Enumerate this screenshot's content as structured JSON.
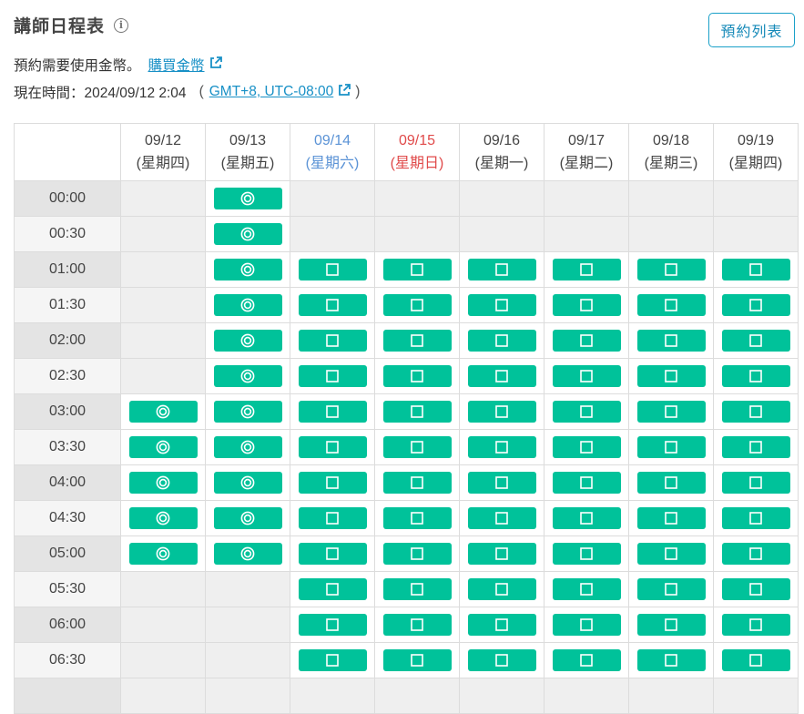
{
  "header": {
    "title": "講師日程表",
    "list_button": "預約列表"
  },
  "info": {
    "coins_text": "預約需要使用金幣。",
    "buy_link": "購買金幣",
    "time_label": "現在時間：2024/09/12 2:04",
    "paren_open": "(",
    "tz_link": "GMT+8, UTC-08:00",
    "paren_close": ")"
  },
  "schedule": {
    "days": [
      {
        "date": "09/12",
        "weekday": "(星期四)",
        "type": "weekday"
      },
      {
        "date": "09/13",
        "weekday": "(星期五)",
        "type": "weekday"
      },
      {
        "date": "09/14",
        "weekday": "(星期六)",
        "type": "saturday"
      },
      {
        "date": "09/15",
        "weekday": "(星期日)",
        "type": "sunday"
      },
      {
        "date": "09/16",
        "weekday": "(星期一)",
        "type": "weekday"
      },
      {
        "date": "09/17",
        "weekday": "(星期二)",
        "type": "weekday"
      },
      {
        "date": "09/18",
        "weekday": "(星期三)",
        "type": "weekday"
      },
      {
        "date": "09/19",
        "weekday": "(星期四)",
        "type": "weekday"
      }
    ],
    "legend": {
      "double_circle": "circle-slot-icon",
      "square": "square-slot-icon"
    },
    "rows": [
      {
        "time": "00:00",
        "slots": [
          "",
          "O",
          "",
          "",
          "",
          "",
          "",
          ""
        ]
      },
      {
        "time": "00:30",
        "slots": [
          "",
          "O",
          "",
          "",
          "",
          "",
          "",
          ""
        ]
      },
      {
        "time": "01:00",
        "slots": [
          "",
          "O",
          "S",
          "S",
          "S",
          "S",
          "S",
          "S"
        ]
      },
      {
        "time": "01:30",
        "slots": [
          "",
          "O",
          "S",
          "S",
          "S",
          "S",
          "S",
          "S"
        ]
      },
      {
        "time": "02:00",
        "slots": [
          "",
          "O",
          "S",
          "S",
          "S",
          "S",
          "S",
          "S"
        ]
      },
      {
        "time": "02:30",
        "slots": [
          "",
          "O",
          "S",
          "S",
          "S",
          "S",
          "S",
          "S"
        ]
      },
      {
        "time": "03:00",
        "slots": [
          "O",
          "O",
          "S",
          "S",
          "S",
          "S",
          "S",
          "S"
        ]
      },
      {
        "time": "03:30",
        "slots": [
          "O",
          "O",
          "S",
          "S",
          "S",
          "S",
          "S",
          "S"
        ]
      },
      {
        "time": "04:00",
        "slots": [
          "O",
          "O",
          "S",
          "S",
          "S",
          "S",
          "S",
          "S"
        ]
      },
      {
        "time": "04:30",
        "slots": [
          "O",
          "O",
          "S",
          "S",
          "S",
          "S",
          "S",
          "S"
        ]
      },
      {
        "time": "05:00",
        "slots": [
          "O",
          "O",
          "S",
          "S",
          "S",
          "S",
          "S",
          "S"
        ]
      },
      {
        "time": "05:30",
        "slots": [
          "",
          "",
          "S",
          "S",
          "S",
          "S",
          "S",
          "S"
        ]
      },
      {
        "time": "06:00",
        "slots": [
          "",
          "",
          "S",
          "S",
          "S",
          "S",
          "S",
          "S"
        ]
      },
      {
        "time": "06:30",
        "slots": [
          "",
          "",
          "S",
          "S",
          "S",
          "S",
          "S",
          "S"
        ]
      },
      {
        "time": "",
        "slots": [
          "",
          "",
          "",
          "",
          "",
          "",
          "",
          ""
        ]
      }
    ]
  },
  "colors": {
    "slot": "#00c29a",
    "saturday": "#5b93d6",
    "sunday": "#e04a4a",
    "link": "#1890c6"
  }
}
